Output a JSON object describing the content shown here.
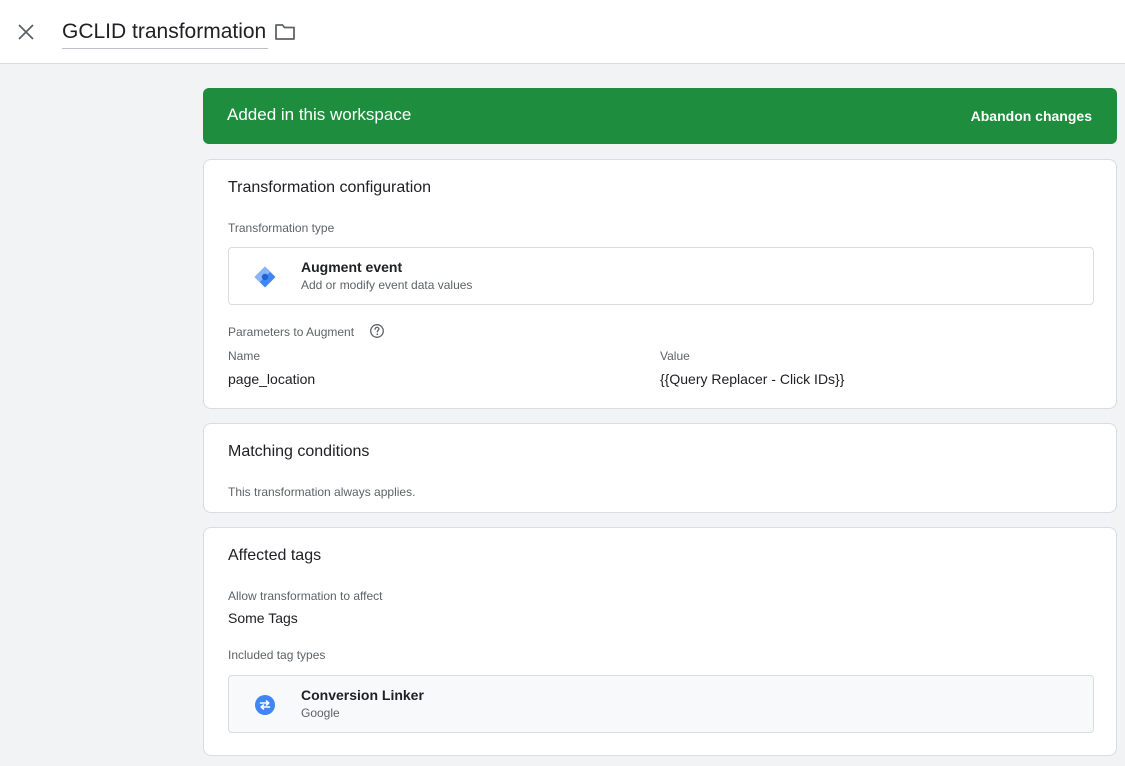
{
  "header": {
    "title": "GCLID transformation",
    "close_icon": "close-icon",
    "folder_icon": "folder-icon"
  },
  "banner": {
    "text": "Added in this workspace",
    "action": "Abandon changes",
    "color": "#1e8e3e"
  },
  "transformation_config": {
    "title": "Transformation configuration",
    "type_label": "Transformation type",
    "type": {
      "name": "Augment event",
      "description": "Add or modify event data values",
      "icon": "tag-manager-diamond-icon"
    },
    "params_label": "Parameters to Augment",
    "params_help_icon": "help-icon",
    "columns": {
      "name": "Name",
      "value": "Value"
    },
    "params": [
      {
        "name": "page_location",
        "value": "{{Query Replacer - Click IDs}}"
      }
    ]
  },
  "matching_conditions": {
    "title": "Matching conditions",
    "text": "This transformation always applies."
  },
  "affected_tags": {
    "title": "Affected tags",
    "allow_label": "Allow transformation to affect",
    "allow_value": "Some Tags",
    "included_label": "Included tag types",
    "tags": [
      {
        "name": "Conversion Linker",
        "vendor": "Google",
        "icon": "conversion-linker-icon",
        "color": "#4285f4"
      }
    ]
  }
}
